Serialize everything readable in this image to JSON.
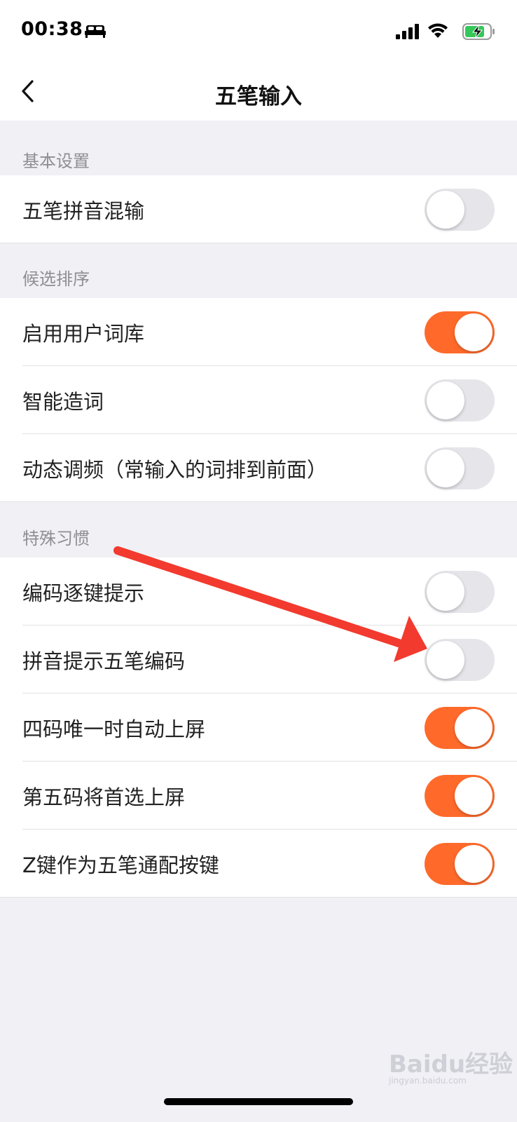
{
  "status_bar": {
    "time": "00:38",
    "icons": [
      "bed-icon",
      "signal-icon",
      "wifi-icon",
      "battery-charging-icon"
    ]
  },
  "nav": {
    "title": "五笔输入",
    "back_icon": "chevron-left-icon"
  },
  "sections": [
    {
      "header": "基本设置",
      "items": [
        {
          "label": "五笔拼音混输",
          "enabled": false
        }
      ]
    },
    {
      "header": "候选排序",
      "items": [
        {
          "label": "启用用户词库",
          "enabled": true
        },
        {
          "label": "智能造词",
          "enabled": false
        },
        {
          "label": "动态调频（常输入的词排到前面）",
          "enabled": false
        }
      ]
    },
    {
      "header": "特殊习惯",
      "items": [
        {
          "label": "编码逐键提示",
          "enabled": false
        },
        {
          "label": "拼音提示五笔编码",
          "enabled": false
        },
        {
          "label": "四码唯一时自动上屏",
          "enabled": true
        },
        {
          "label": "第五码将首选上屏",
          "enabled": true
        },
        {
          "label": "Z键作为五笔通配按键",
          "enabled": true
        }
      ]
    }
  ],
  "colors": {
    "accent": "#ff6a2b",
    "toggle_off": "#e5e5ea",
    "background": "#f0f0f5",
    "annotation_arrow": "#f23a2e"
  },
  "watermark": {
    "text": "Baidu经验",
    "sub": "jingyan.baidu.com"
  }
}
